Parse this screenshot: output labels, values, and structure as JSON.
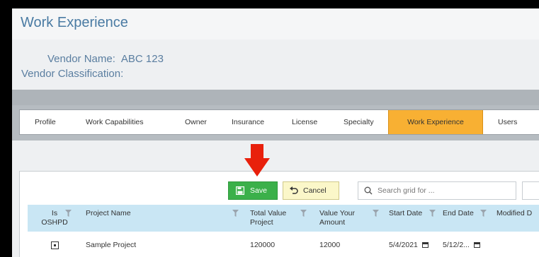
{
  "page": {
    "title": "Work Experience"
  },
  "vendor": {
    "name_label": "Vendor Name:",
    "name_value": "ABC 123",
    "classification_label": "Vendor Classification:"
  },
  "tabs": [
    {
      "label": "Profile"
    },
    {
      "label": "Work Capabilities"
    },
    {
      "label": "Owner"
    },
    {
      "label": "Insurance"
    },
    {
      "label": "License"
    },
    {
      "label": "Specialty"
    },
    {
      "label": "Work Experience"
    },
    {
      "label": "Users"
    }
  ],
  "active_tab": "Work Experience",
  "toolbar": {
    "save_label": "Save",
    "cancel_label": "Cancel",
    "search_placeholder": "Search grid for ..."
  },
  "grid": {
    "columns": [
      {
        "line1": "Is",
        "line2": "OSHPD"
      },
      {
        "line1": "Project Name",
        "line2": ""
      },
      {
        "line1": "Total Value",
        "line2": "Project"
      },
      {
        "line1": "Value Your",
        "line2": "Amount"
      },
      {
        "line1": "Start Date",
        "line2": ""
      },
      {
        "line1": "End Date",
        "line2": ""
      },
      {
        "line1": "Modified D",
        "line2": ""
      }
    ],
    "rows": [
      {
        "is_oshpd": true,
        "project_name": "Sample Project",
        "total_value": "120000",
        "your_amount": "12000",
        "start_date": "5/4/2021",
        "end_date": "5/12/2...",
        "modified": ""
      }
    ]
  },
  "colors": {
    "accent_tab": "#f8b033",
    "save_green": "#3bb04a",
    "cancel_yellow": "#fbf7c9",
    "grid_header": "#c9e6f4",
    "annotation_arrow": "#e8200c"
  }
}
